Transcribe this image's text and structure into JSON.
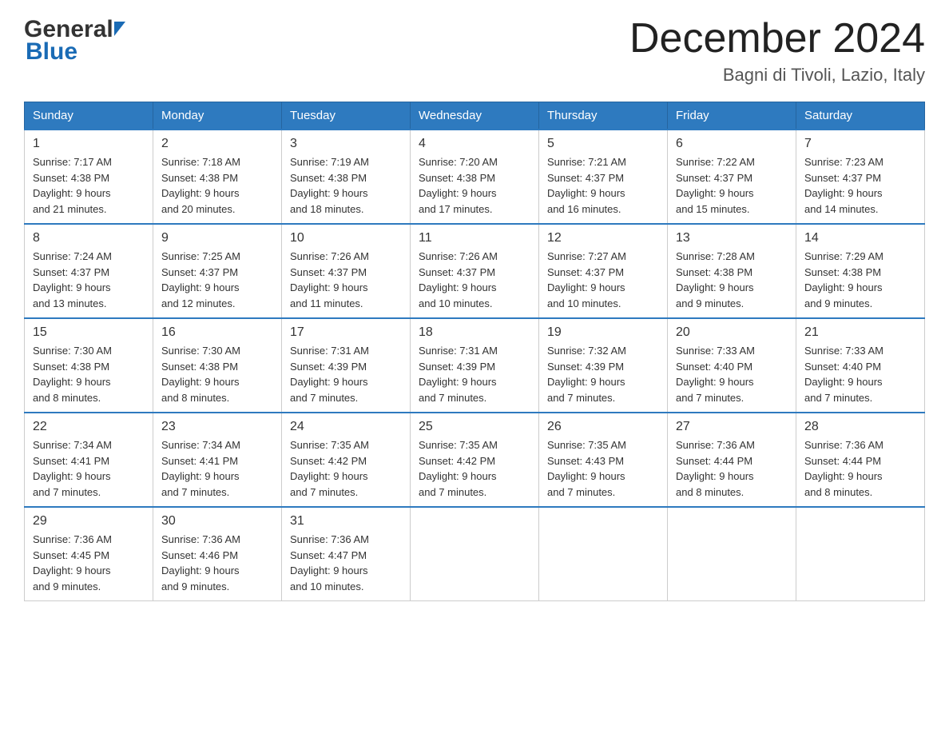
{
  "header": {
    "logo_text1": "General",
    "logo_text2": "Blue",
    "month_title": "December 2024",
    "location": "Bagni di Tivoli, Lazio, Italy"
  },
  "days_of_week": [
    "Sunday",
    "Monday",
    "Tuesday",
    "Wednesday",
    "Thursday",
    "Friday",
    "Saturday"
  ],
  "weeks": [
    [
      {
        "day": "1",
        "sunrise": "7:17 AM",
        "sunset": "4:38 PM",
        "daylight": "9 hours and 21 minutes."
      },
      {
        "day": "2",
        "sunrise": "7:18 AM",
        "sunset": "4:38 PM",
        "daylight": "9 hours and 20 minutes."
      },
      {
        "day": "3",
        "sunrise": "7:19 AM",
        "sunset": "4:38 PM",
        "daylight": "9 hours and 18 minutes."
      },
      {
        "day": "4",
        "sunrise": "7:20 AM",
        "sunset": "4:38 PM",
        "daylight": "9 hours and 17 minutes."
      },
      {
        "day": "5",
        "sunrise": "7:21 AM",
        "sunset": "4:37 PM",
        "daylight": "9 hours and 16 minutes."
      },
      {
        "day": "6",
        "sunrise": "7:22 AM",
        "sunset": "4:37 PM",
        "daylight": "9 hours and 15 minutes."
      },
      {
        "day": "7",
        "sunrise": "7:23 AM",
        "sunset": "4:37 PM",
        "daylight": "9 hours and 14 minutes."
      }
    ],
    [
      {
        "day": "8",
        "sunrise": "7:24 AM",
        "sunset": "4:37 PM",
        "daylight": "9 hours and 13 minutes."
      },
      {
        "day": "9",
        "sunrise": "7:25 AM",
        "sunset": "4:37 PM",
        "daylight": "9 hours and 12 minutes."
      },
      {
        "day": "10",
        "sunrise": "7:26 AM",
        "sunset": "4:37 PM",
        "daylight": "9 hours and 11 minutes."
      },
      {
        "day": "11",
        "sunrise": "7:26 AM",
        "sunset": "4:37 PM",
        "daylight": "9 hours and 10 minutes."
      },
      {
        "day": "12",
        "sunrise": "7:27 AM",
        "sunset": "4:37 PM",
        "daylight": "9 hours and 10 minutes."
      },
      {
        "day": "13",
        "sunrise": "7:28 AM",
        "sunset": "4:38 PM",
        "daylight": "9 hours and 9 minutes."
      },
      {
        "day": "14",
        "sunrise": "7:29 AM",
        "sunset": "4:38 PM",
        "daylight": "9 hours and 9 minutes."
      }
    ],
    [
      {
        "day": "15",
        "sunrise": "7:30 AM",
        "sunset": "4:38 PM",
        "daylight": "9 hours and 8 minutes."
      },
      {
        "day": "16",
        "sunrise": "7:30 AM",
        "sunset": "4:38 PM",
        "daylight": "9 hours and 8 minutes."
      },
      {
        "day": "17",
        "sunrise": "7:31 AM",
        "sunset": "4:39 PM",
        "daylight": "9 hours and 7 minutes."
      },
      {
        "day": "18",
        "sunrise": "7:31 AM",
        "sunset": "4:39 PM",
        "daylight": "9 hours and 7 minutes."
      },
      {
        "day": "19",
        "sunrise": "7:32 AM",
        "sunset": "4:39 PM",
        "daylight": "9 hours and 7 minutes."
      },
      {
        "day": "20",
        "sunrise": "7:33 AM",
        "sunset": "4:40 PM",
        "daylight": "9 hours and 7 minutes."
      },
      {
        "day": "21",
        "sunrise": "7:33 AM",
        "sunset": "4:40 PM",
        "daylight": "9 hours and 7 minutes."
      }
    ],
    [
      {
        "day": "22",
        "sunrise": "7:34 AM",
        "sunset": "4:41 PM",
        "daylight": "9 hours and 7 minutes."
      },
      {
        "day": "23",
        "sunrise": "7:34 AM",
        "sunset": "4:41 PM",
        "daylight": "9 hours and 7 minutes."
      },
      {
        "day": "24",
        "sunrise": "7:35 AM",
        "sunset": "4:42 PM",
        "daylight": "9 hours and 7 minutes."
      },
      {
        "day": "25",
        "sunrise": "7:35 AM",
        "sunset": "4:42 PM",
        "daylight": "9 hours and 7 minutes."
      },
      {
        "day": "26",
        "sunrise": "7:35 AM",
        "sunset": "4:43 PM",
        "daylight": "9 hours and 7 minutes."
      },
      {
        "day": "27",
        "sunrise": "7:36 AM",
        "sunset": "4:44 PM",
        "daylight": "9 hours and 8 minutes."
      },
      {
        "day": "28",
        "sunrise": "7:36 AM",
        "sunset": "4:44 PM",
        "daylight": "9 hours and 8 minutes."
      }
    ],
    [
      {
        "day": "29",
        "sunrise": "7:36 AM",
        "sunset": "4:45 PM",
        "daylight": "9 hours and 9 minutes."
      },
      {
        "day": "30",
        "sunrise": "7:36 AM",
        "sunset": "4:46 PM",
        "daylight": "9 hours and 9 minutes."
      },
      {
        "day": "31",
        "sunrise": "7:36 AM",
        "sunset": "4:47 PM",
        "daylight": "9 hours and 10 minutes."
      },
      null,
      null,
      null,
      null
    ]
  ],
  "labels": {
    "sunrise": "Sunrise:",
    "sunset": "Sunset:",
    "daylight": "Daylight:"
  }
}
